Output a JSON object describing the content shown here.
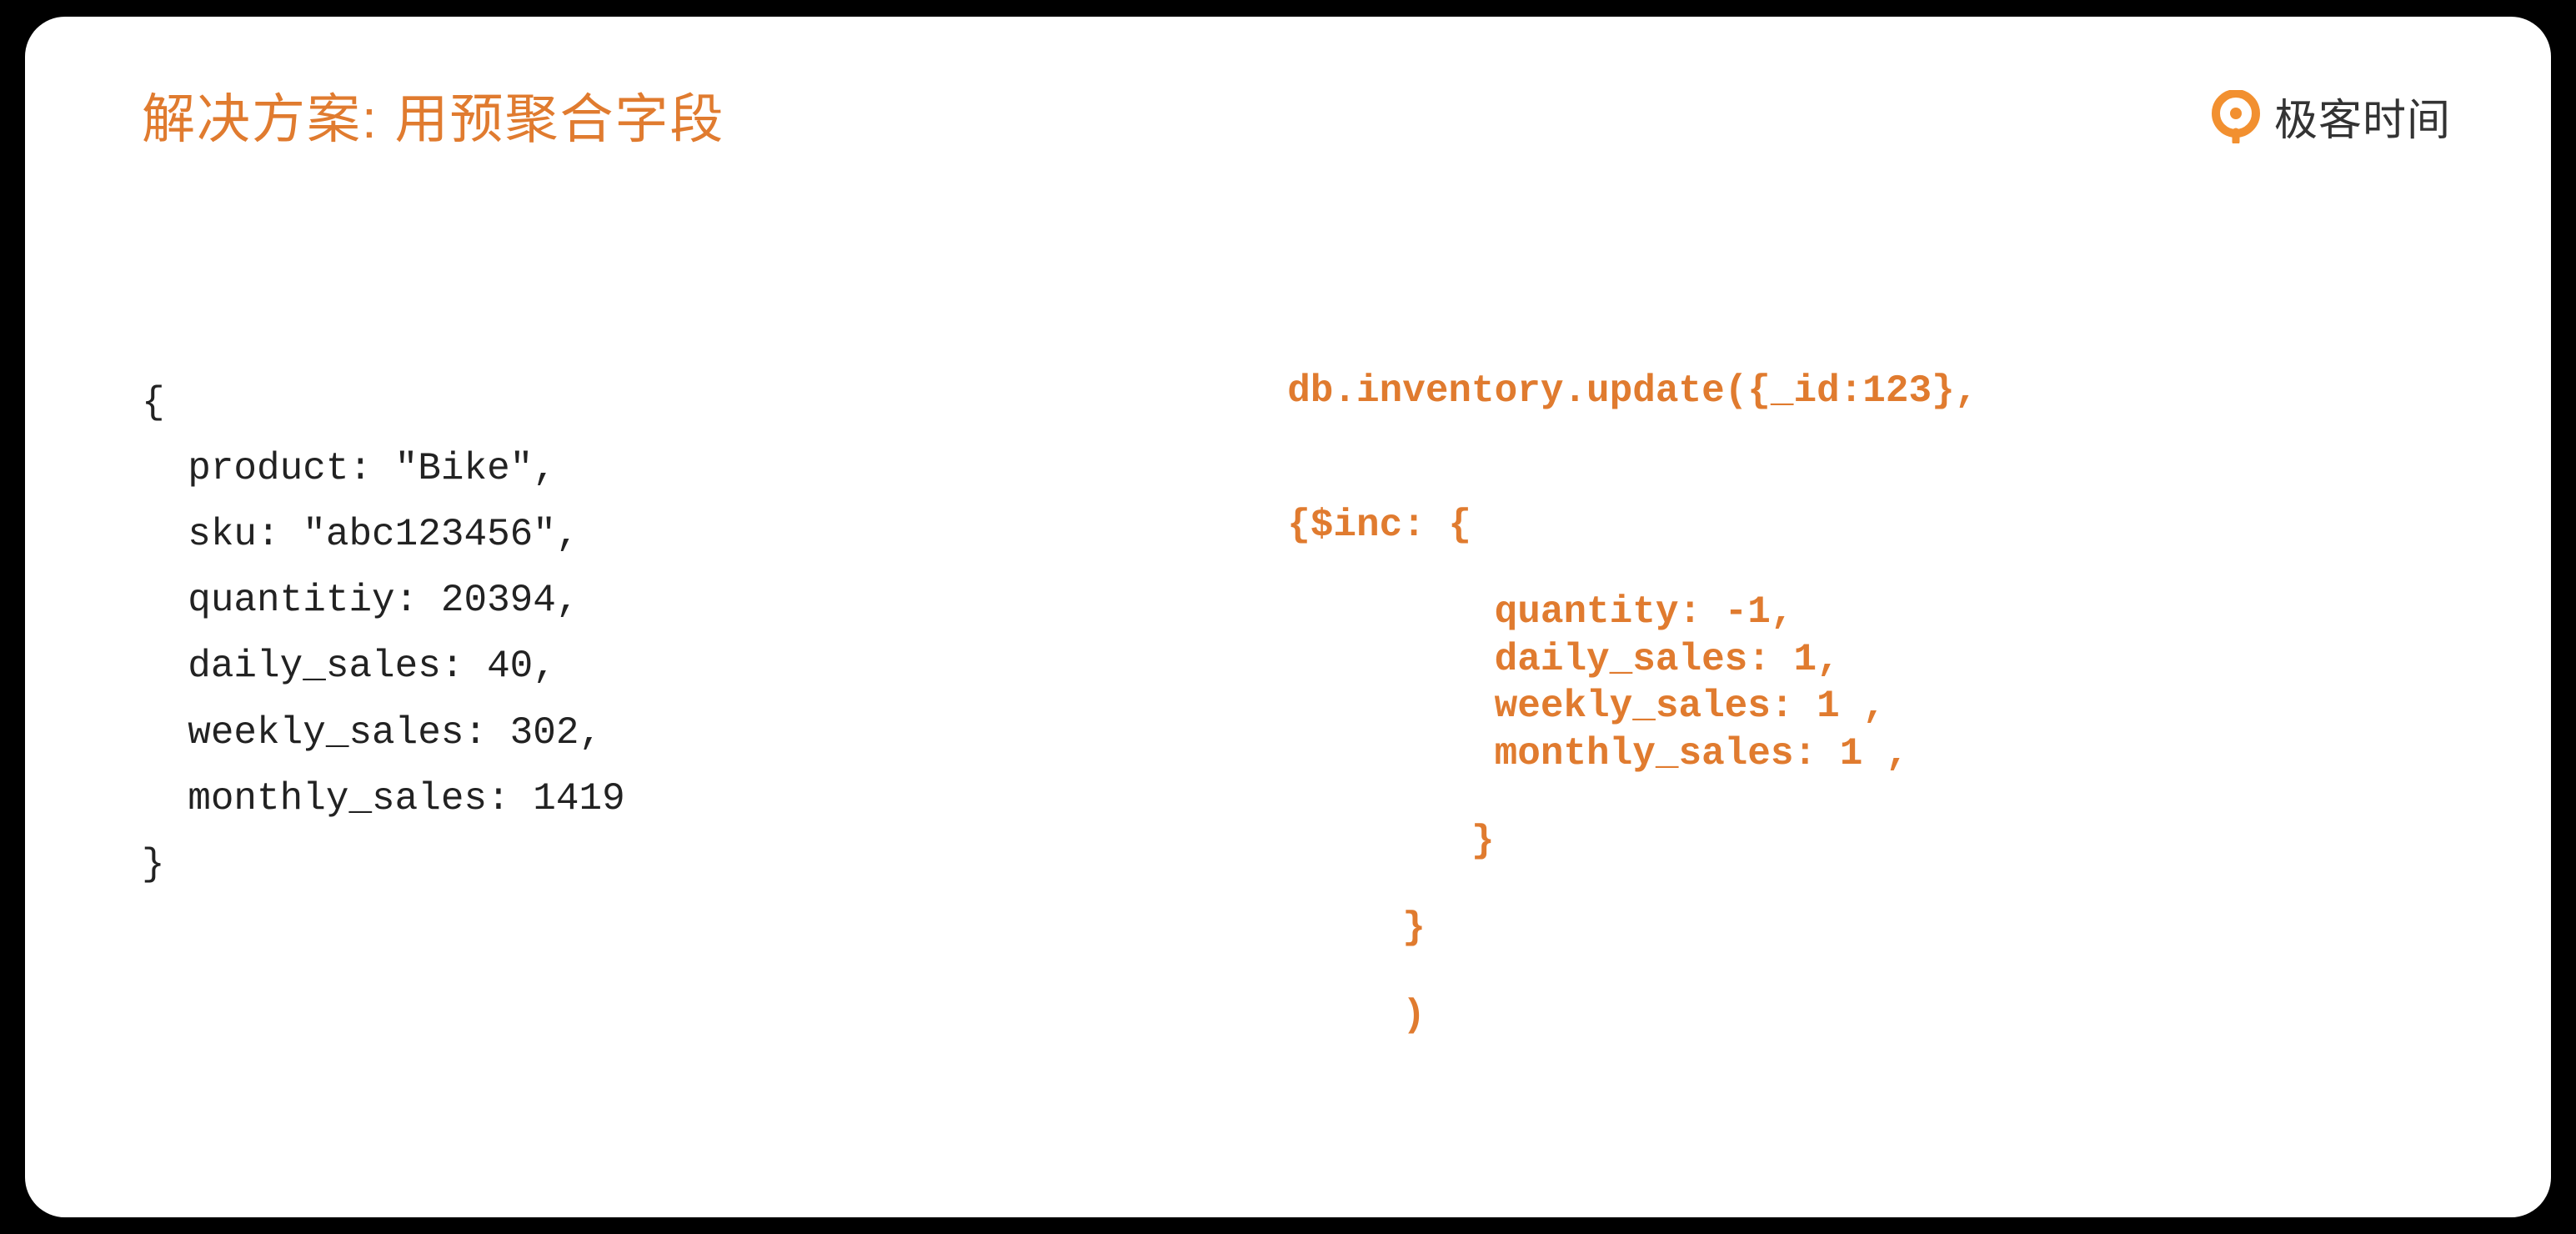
{
  "header": {
    "title": "解决方案: 用预聚合字段",
    "brand_text": "极客时间"
  },
  "left_code": {
    "l1": "{",
    "l2": "  product: \"Bike\",",
    "l3": "  sku: \"abc123456\",",
    "l4": "  quantitiy: 20394,",
    "l5": "  daily_sales: 40,",
    "l6": "  weekly_sales: 302,",
    "l7": "  monthly_sales: 1419",
    "l8": "}"
  },
  "right_code": {
    "r1": "db.inventory.update({_id:123},",
    "r2": "{$inc: {",
    "r3": "         quantity: -1,",
    "r4": "         daily_sales: 1,",
    "r5": "         weekly_sales: 1 ,",
    "r6": "         monthly_sales: 1 ,",
    "r7": "        }",
    "r8": "     }",
    "r9": "     )"
  }
}
